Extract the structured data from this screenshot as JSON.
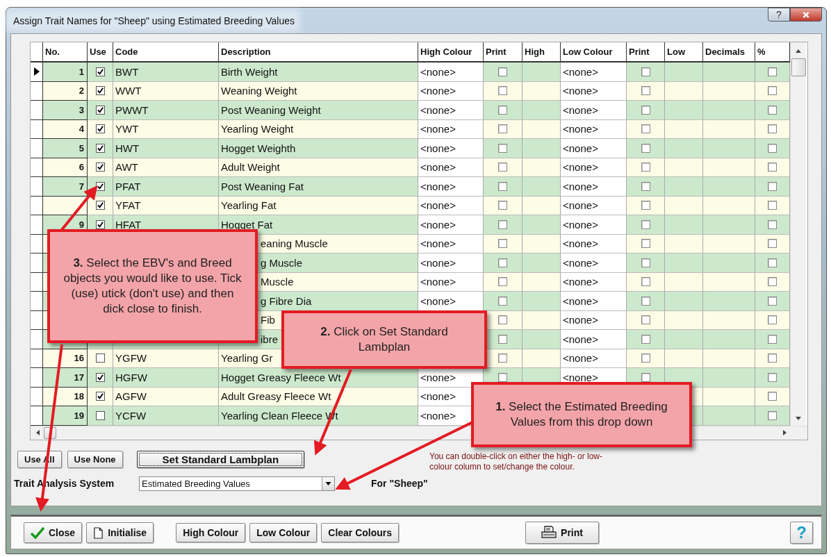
{
  "window": {
    "title": "Assign Trait Names for \"Sheep\" using Estimated Breeding Values",
    "help_glyph": "?"
  },
  "table": {
    "columns": [
      "No.",
      "Use",
      "Code",
      "Description",
      "High Colour",
      "Print",
      "High",
      "Low Colour",
      "Print",
      "Low",
      "Decimals",
      "%"
    ],
    "rows": [
      {
        "current": true,
        "no": "1",
        "use": true,
        "code": "BWT",
        "description": "Birth Weight",
        "high_colour": "<none>",
        "high_print": false,
        "low_colour": "<none>",
        "low_print": false,
        "percent": false
      },
      {
        "current": false,
        "no": "2",
        "use": true,
        "code": "WWT",
        "description": "Weaning Weight",
        "high_colour": "<none>",
        "high_print": false,
        "low_colour": "<none>",
        "low_print": false,
        "percent": false
      },
      {
        "current": false,
        "no": "3",
        "use": true,
        "code": "PWWT",
        "description": "Post Weaning Weight",
        "high_colour": "<none>",
        "high_print": false,
        "low_colour": "<none>",
        "low_print": false,
        "percent": false
      },
      {
        "current": false,
        "no": "4",
        "use": true,
        "code": "YWT",
        "description": "Yearling Weight",
        "high_colour": "<none>",
        "high_print": false,
        "low_colour": "<none>",
        "low_print": false,
        "percent": false
      },
      {
        "current": false,
        "no": "5",
        "use": true,
        "code": "HWT",
        "description": "Hogget Weighth",
        "high_colour": "<none>",
        "high_print": false,
        "low_colour": "<none>",
        "low_print": false,
        "percent": false
      },
      {
        "current": false,
        "no": "6",
        "use": true,
        "code": "AWT",
        "description": "Adult Weight",
        "high_colour": "<none>",
        "high_print": false,
        "low_colour": "<none>",
        "low_print": false,
        "percent": false
      },
      {
        "current": false,
        "no": "7",
        "use": true,
        "code": "PFAT",
        "description": "Post Weaning Fat",
        "high_colour": "<none>",
        "high_print": false,
        "low_colour": "<none>",
        "low_print": false,
        "percent": false
      },
      {
        "current": false,
        "use": true,
        "code": "YFAT",
        "description": "Yearling Fat",
        "high_colour": "<none>",
        "high_print": false,
        "low_colour": "<none>",
        "low_print": false,
        "percent": false
      },
      {
        "current": false,
        "no": "9",
        "use": true,
        "code": "HFAT",
        "description": "Hogget Fat",
        "high_colour": "<none>",
        "high_print": false,
        "low_colour": "<none>",
        "low_print": false,
        "percent": false
      },
      {
        "current": false,
        "description": "eaning Muscle",
        "high_colour": "<none>",
        "high_print": false,
        "low_colour": "<none>",
        "low_print": false,
        "percent": false
      },
      {
        "current": false,
        "description": "g Muscle",
        "high_colour": "<none>",
        "high_print": false,
        "low_colour": "<none>",
        "low_print": false,
        "percent": false
      },
      {
        "current": false,
        "description": "Muscle",
        "high_colour": "<none>",
        "high_print": false,
        "low_colour": "<none>",
        "low_print": false,
        "percent": false
      },
      {
        "current": false,
        "description": "g Fibre Dia",
        "high_colour": "<none>",
        "high_print": false,
        "low_colour": "<none>",
        "low_print": false,
        "percent": false
      },
      {
        "current": false,
        "description": "Fib",
        "high_print": false,
        "low_colour": "<none>",
        "low_print": false,
        "percent": false
      },
      {
        "current": false,
        "description": "ibre",
        "high_print": false,
        "low_colour": "<none>",
        "low_print": false,
        "percent": false
      },
      {
        "current": false,
        "no": "16",
        "use": false,
        "code": "YGFW",
        "description": "Yearling Gr",
        "high_print": false,
        "low_colour": "<none>",
        "low_print": false,
        "percent": false
      },
      {
        "current": false,
        "no": "17",
        "use": true,
        "code": "HGFW",
        "description": "Hogget Greasy Fleece Wt",
        "high_colour": "<none>",
        "high_print": false,
        "low_colour": "<none>",
        "low_print": false,
        "percent": false
      },
      {
        "current": false,
        "no": "18",
        "use": true,
        "code": "AGFW",
        "description": "Adult Greasy Fleece Wt",
        "high_colour": "<none>",
        "percent": false
      },
      {
        "current": false,
        "no": "19",
        "use": false,
        "code": "YCFW",
        "description": "Yearling Clean Fleece Wt",
        "high_colour": "<none>",
        "percent": false
      }
    ]
  },
  "buttons": [
    {
      "label": "Use All",
      "focused": false
    },
    {
      "label": "Use None",
      "focused": false
    },
    {
      "label": "Set Standard Lambplan",
      "focused": true
    }
  ],
  "note": "You can double-click on either the high- or low-colour column to set/change the colour.",
  "trait_system": {
    "label": "Trait Analysis System",
    "value": "Estimated Breeding Values",
    "suffix": "For \"Sheep\""
  },
  "toolbar": {
    "left": [
      {
        "label": "Close"
      },
      {
        "label": "Initialise"
      }
    ],
    "middle": [
      {
        "label": "High Colour"
      },
      {
        "label": "Low Colour"
      },
      {
        "label": "Clear Colours"
      }
    ],
    "print": {
      "label": "Print"
    },
    "help": "?"
  },
  "callouts": [
    {
      "text": "**3.** Select the EBV's and Breed objects you would like to use. Tick (use) utick (don't use) and then dick close to finish."
    },
    {
      "text": "**2.** Click on Set Standard Lambplan"
    },
    {
      "text": "**1.** Select the Estimated Breeding Values from this drop down"
    }
  ]
}
